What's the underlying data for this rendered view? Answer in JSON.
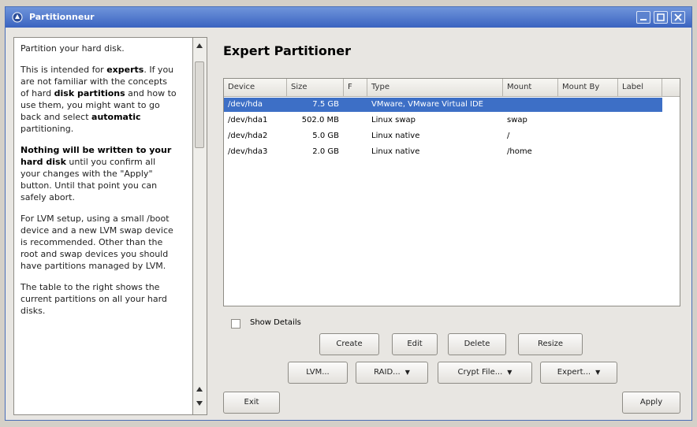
{
  "window": {
    "title": "Partitionneur",
    "icon": "app-logo-icon"
  },
  "help": {
    "paragraphs": [
      "Partition your hard disk.",
      "This is intended for <b>experts</b>. If you are not familiar with the concepts of hard <b>disk partitions</b> and how to use them, you might want to go back and select <b>automatic</b> partitioning.",
      "<b>Nothing will be written to your hard disk</b> until you confirm all your changes with the \"Apply\" button. Until that point you can safely abort.",
      "For LVM setup, using a small /boot device and a new LVM swap device is recommended. Other than the root and swap devices you should have partitions managed by LVM.",
      "The table to the right shows the current partitions on all your hard disks."
    ]
  },
  "heading": "Expert Partitioner",
  "table": {
    "columns": [
      "Device",
      "Size",
      "F",
      "Type",
      "Mount",
      "Mount By",
      "Label"
    ],
    "rows": [
      {
        "device": "/dev/hda",
        "size": "7.5 GB",
        "f": "",
        "type": "VMware, VMware Virtual IDE",
        "mount": "",
        "selected": true
      },
      {
        "device": "/dev/hda1",
        "size": "502.0 MB",
        "f": "",
        "type": "Linux swap",
        "mount": "swap",
        "selected": false
      },
      {
        "device": "/dev/hda2",
        "size": "5.0 GB",
        "f": "",
        "type": "Linux native",
        "mount": "/",
        "selected": false
      },
      {
        "device": "/dev/hda3",
        "size": "2.0 GB",
        "f": "",
        "type": "Linux native",
        "mount": "/home",
        "selected": false
      }
    ]
  },
  "show_details": "Show Details",
  "buttons": {
    "create": "Create",
    "edit": "Edit",
    "delete": "Delete",
    "resize": "Resize",
    "lvm": "LVM...",
    "raid": "RAID...",
    "crypt": "Crypt File...",
    "expert": "Expert...",
    "exit": "Exit",
    "apply": "Apply"
  },
  "colors": {
    "titlebar": "#3a63c0",
    "selection": "#3d6fc6"
  }
}
